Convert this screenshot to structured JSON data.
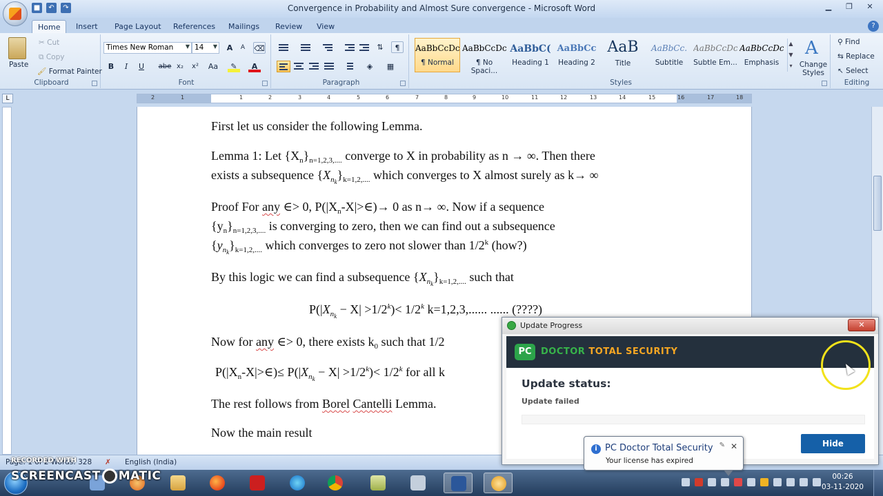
{
  "window": {
    "title": "Convergence in Probability and Almost Sure convergence - Microsoft Word"
  },
  "ribbon_tabs": [
    "Home",
    "Insert",
    "Page Layout",
    "References",
    "Mailings",
    "Review",
    "View"
  ],
  "clipboard": {
    "paste": "Paste",
    "cut": "Cut",
    "copy": "Copy",
    "format_painter": "Format Painter",
    "label": "Clipboard"
  },
  "font": {
    "family": "Times New Roman",
    "size": "14",
    "label": "Font",
    "bold": "B",
    "italic": "I",
    "underline": "U",
    "strike": "abe",
    "subscript": "x₂",
    "superscript": "x²",
    "change_case": "Aa",
    "grow": "A",
    "shrink": "A"
  },
  "paragraph": {
    "label": "Paragraph"
  },
  "styles": {
    "label": "Styles",
    "items": [
      {
        "sample": "AaBbCcDc",
        "name": "¶ Normal"
      },
      {
        "sample": "AaBbCcDc",
        "name": "¶ No Spaci..."
      },
      {
        "sample": "AaBbC(",
        "name": "Heading 1"
      },
      {
        "sample": "AaBbCc",
        "name": "Heading 2"
      },
      {
        "sample": "AaB",
        "name": "Title"
      },
      {
        "sample": "AaBbCc.",
        "name": "Subtitle"
      },
      {
        "sample": "AaBbCcDc",
        "name": "Subtle Em..."
      },
      {
        "sample": "AaBbCcDc",
        "name": "Emphasis"
      }
    ],
    "change_styles": "Change Styles"
  },
  "editing": {
    "label": "Editing",
    "find": "Find",
    "replace": "Replace",
    "select": "Select"
  },
  "ruler": {
    "numbers": [
      "2",
      "1",
      "1",
      "2",
      "3",
      "4",
      "5",
      "6",
      "7",
      "8",
      "9",
      "10",
      "11",
      "12",
      "13",
      "14",
      "15",
      "16",
      "17",
      "18"
    ]
  },
  "document": {
    "line1": "First let us consider the following Lemma.",
    "lemma_a": "Lemma 1:  Let {X",
    "lemma_sub1": "n",
    "lemma_b": "}",
    "lemma_sub2": "n=1,2,3,....",
    "lemma_c": "  converge to X  in probability as n → ∞. Then there",
    "exists_a": "exists a subsequence {",
    "exists_x": "X",
    "exists_sub": "n",
    "exists_subsub": "k",
    "exists_b": "}",
    "exists_sub2": "k=1,2,....",
    "exists_c": " which converges to X almost surely as k→ ∞",
    "proof_a": "Proof   For ",
    "proof_any": "any",
    "proof_b": "  ∈> 0,   P(|X",
    "proof_sub": "n",
    "proof_c": "-X|>∈)→ 0   as n→ ∞.  Now if a sequence",
    "y1_a": "{y",
    "y1_sub": "n",
    "y1_b": "}",
    "y1_sub2": "n=1,2,3,....",
    "y1_c": "  is converging to zero, then we can find out a subsequence",
    "y2_a": "{",
    "y2_y": "y",
    "y2_sub": "n",
    "y2_subsub": "k",
    "y2_b": "}",
    "y2_sub2": "k=1,2,....",
    "y2_c": "  which converges to zero not slower than 1/2",
    "y2_sup": "k",
    "y2_d": "  (how?)",
    "logic_a": "By this logic we can find a subsequence {",
    "logic_x": "X",
    "logic_sub": "n",
    "logic_subsub": "k",
    "logic_b": "}",
    "logic_sub2": "k=1,2,....",
    "logic_c": " such that",
    "eq_a": "P(|",
    "eq_x": "X",
    "eq_sub": "n",
    "eq_subsub": "k",
    "eq_b": " − X| >1/2",
    "eq_sup1": "k",
    "eq_c": ")< 1/2",
    "eq_sup2": "k",
    "eq_d": "  k=1,2,3,...... ...... (????)",
    "now_a": "Now for ",
    "now_any": "any",
    "now_b": "  ∈> 0,  there exists k",
    "now_sub": "0",
    "now_c": "  such that   1/2",
    "p2_a": "P(|X",
    "p2_sub": "n",
    "p2_b": "-X|>∈)≤ P(|",
    "p2_x": "X",
    "p2_sub2": "n",
    "p2_subsub": "k",
    "p2_c": " − X| >1/2",
    "p2_sup1": "k",
    "p2_d": ")< 1/2",
    "p2_sup2": "k",
    "p2_e": " for all k",
    "rest_a": "The rest follows from ",
    "rest_borel": "Borel",
    "rest_sp": " ",
    "rest_cantelli": "Cantelli",
    "rest_b": " Lemma.",
    "main": "Now the main result"
  },
  "statusbar": {
    "words": "Page: 1 of 2   Words: 328",
    "language": "English (India)"
  },
  "watermark": {
    "top": "RECORDED WITH",
    "main_a": "SCREENCAST",
    "main_b": "MATIC"
  },
  "popup": {
    "title": "Update Progress",
    "close": "✕",
    "brand_a": "DOCTOR",
    "brand_b": "TOTAL SECURITY",
    "logo": "PC",
    "status_label": "Update status:",
    "status": "Update failed",
    "hide": "Hide"
  },
  "balloon": {
    "title": "PC Doctor Total Security",
    "message": "Your license has expired",
    "close": "✕"
  },
  "clock": {
    "time": "00:26",
    "date": "03-11-2020"
  }
}
